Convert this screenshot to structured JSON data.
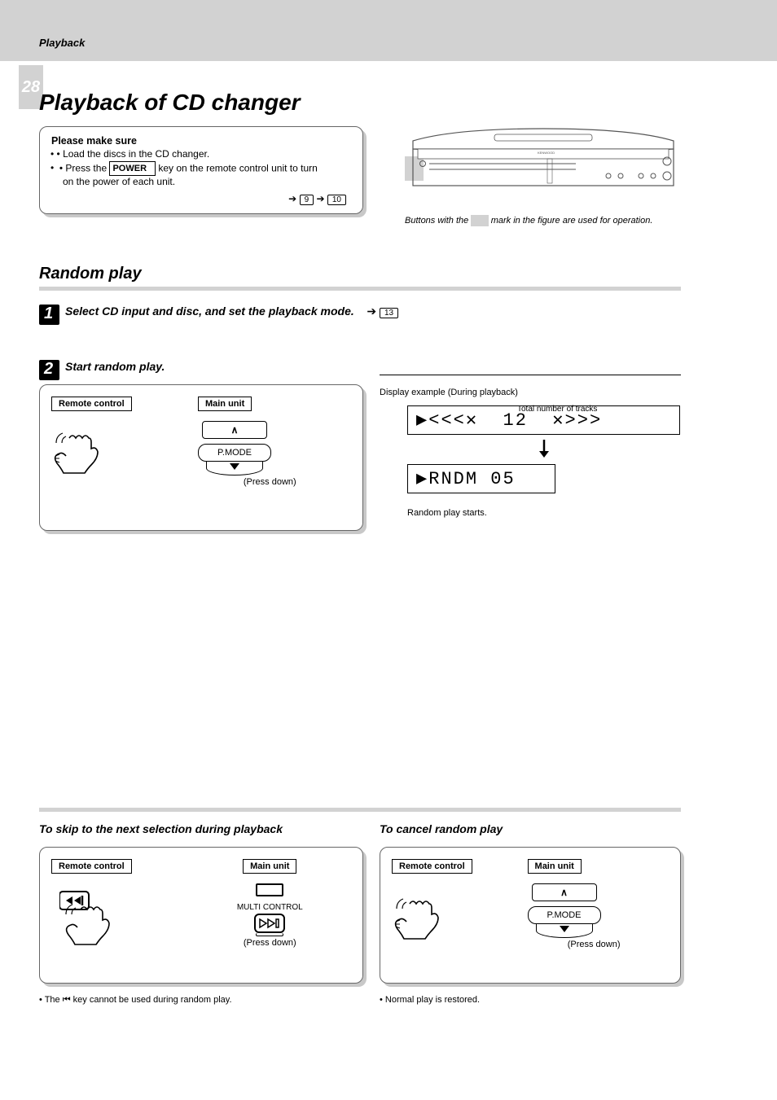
{
  "header": {
    "section_label": "Playback",
    "page_number": "28",
    "title": "Playback of CD changer"
  },
  "prep_box": {
    "label": "Please make sure",
    "item1": "• Load the discs in the CD changer.",
    "item2_prefix": "• Press the",
    "power_btn_label": "POWER",
    "item2_suffix": "key on the remote control unit to turn",
    "item3": "on the power of each unit.",
    "ref1": "9",
    "ref2": "10",
    "arrow": "➔"
  },
  "device": {
    "caption_prefix": "Buttons with the",
    "caption_highlighted": "         ",
    "caption_suffix": "mark in the figure are used for operation."
  },
  "random_play": {
    "title": "Random play",
    "step1": "Select CD input and disc, and set the playback mode.",
    "step1_ref": "13",
    "arrow": "➔",
    "step2": "Start random play.",
    "panel": {
      "left_label": "Remote control",
      "right_label": "Main unit",
      "up_label": "∧",
      "main_btn": "P.MODE",
      "down_label": "down-triangle",
      "press_instr": "(Press down)"
    },
    "display_note": "Display example (During playback)",
    "lcd1": "▶ <<<✕  12  ✕>>>",
    "lcd2": "▶ RNDM 05",
    "total_tracks_label": "Total number of tracks",
    "rndm_caption": "Random play starts."
  },
  "skip_section": {
    "title": "To skip to the next selection during playback",
    "panel": {
      "left_label": "Remote control",
      "right_label": "Main unit",
      "main_btn": "MULTI CONTROL",
      "press_instr": "(Press down)",
      "remote_btn_icon": ">>|"
    },
    "note": "• The ⏮ key cannot be used during random play."
  },
  "cancel_section": {
    "title": "To cancel random play",
    "panel": {
      "left_label": "Remote control",
      "right_label": "Main unit",
      "up_label": "∧",
      "main_btn": "P.MODE",
      "press_instr": "(Press down)"
    },
    "note": "• Normal play is restored."
  }
}
